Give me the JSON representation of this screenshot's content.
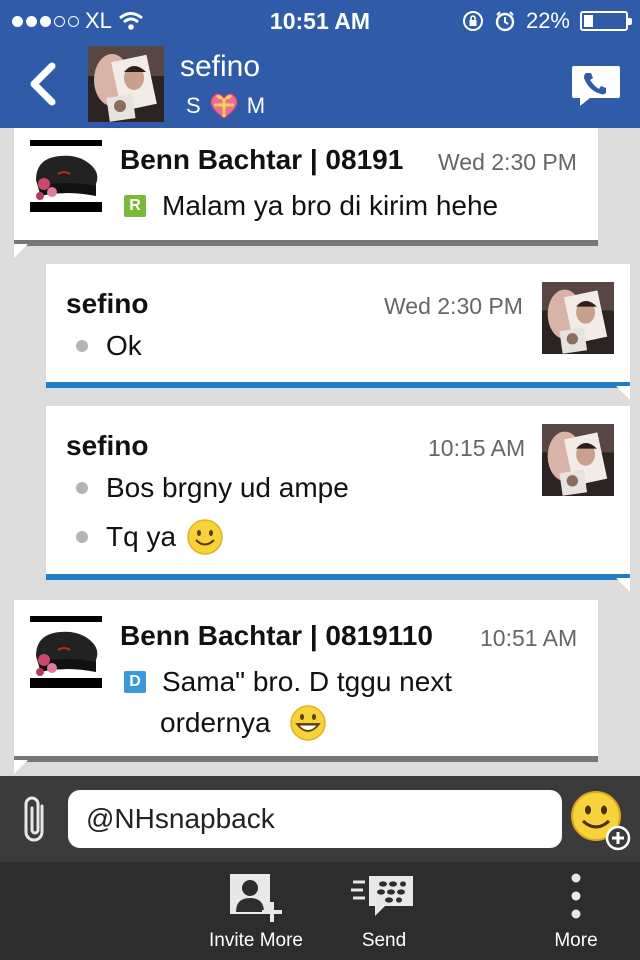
{
  "status_bar": {
    "carrier": "XL",
    "time": "10:51 AM",
    "battery": "22%",
    "battery_level": 0.22
  },
  "header": {
    "contact_name": "sefino",
    "status_left": "S",
    "status_right": "M"
  },
  "messages": [
    {
      "sender": "Benn Bachtar | 08191",
      "time": "Wed 2:30 PM",
      "badge": "R",
      "lines": [
        "Malam ya bro di kirim hehe"
      ]
    },
    {
      "sender": "sefino",
      "time": "Wed 2:30 PM",
      "lines": [
        "Ok"
      ]
    },
    {
      "sender": "sefino",
      "time": "10:15 AM",
      "lines": [
        "Bos brgny ud ampe",
        "Tq ya"
      ]
    },
    {
      "sender": "Benn Bachtar | 0819110",
      "time": "10:51 AM",
      "badge": "D",
      "lines": [
        "Sama\" bro. D tggu next",
        "ordernya"
      ]
    }
  ],
  "composer": {
    "value": "@NHsnapback"
  },
  "toolbar": {
    "invite_label": "Invite More",
    "send_label": "Send",
    "more_label": "More"
  },
  "colors": {
    "header_blue": "#2f5ba8",
    "outgoing_accent": "#1c7fc8",
    "badge_r": "#7ab93a",
    "badge_d": "#3a9ad9"
  }
}
